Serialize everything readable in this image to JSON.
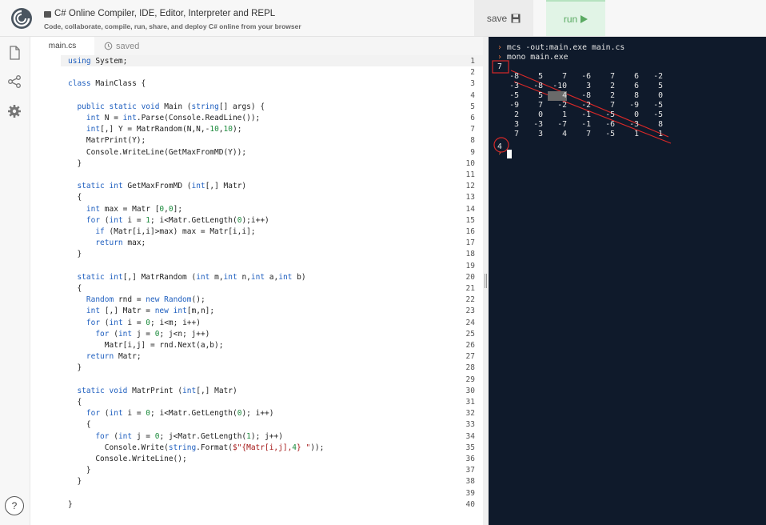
{
  "app": {
    "title": "C# Online Compiler, IDE, Editor, Interpreter and REPL",
    "subtitle": "Code, collaborate, compile, run, share, and deploy C# online from your browser"
  },
  "toolbar": {
    "save_label": "save",
    "run_label": "run"
  },
  "tabs": {
    "file": "main.cs",
    "status": "saved"
  },
  "help_label": "?",
  "editor": {
    "lines": [
      "using System;",
      "",
      "class MainClass {",
      "",
      "  public static void Main (string[] args) {",
      "    int N = int.Parse(Console.ReadLine());",
      "    int[,] Y = MatrRandom(N,N,-10,10);",
      "    MatrPrint(Y);",
      "    Console.WriteLine(GetMaxFromMD(Y));",
      "  }",
      "",
      "  static int GetMaxFromMD (int[,] Matr)",
      "  {",
      "    int max = Matr [0,0];",
      "    for (int i = 1; i<Matr.GetLength(0);i++)",
      "      if (Matr[i,i]>max) max = Matr[i,i];",
      "      return max;",
      "  }",
      "",
      "  static int[,] MatrRandom (int m,int n,int a,int b)",
      "  {",
      "    Random rnd = new Random();",
      "    int [,] Matr = new int[m,n];",
      "    for (int i = 0; i<m; i++)",
      "      for (int j = 0; j<n; j++)",
      "        Matr[i,j] = rnd.Next(a,b);",
      "    return Matr;",
      "  }",
      "",
      "  static void MatrPrint (int[,] Matr)",
      "  {",
      "    for (int i = 0; i<Matr.GetLength(0); i++)",
      "    {",
      "      for (int j = 0; j<Matr.GetLength(1); j++)",
      "        Console.Write(string.Format($\"{Matr[i,j],4} \"));",
      "      Console.WriteLine();",
      "    }",
      "  }",
      "",
      "}"
    ]
  },
  "terminal": {
    "commands": [
      "mcs -out:main.exe main.cs",
      "mono main.exe"
    ],
    "input": "7",
    "matrix": [
      [
        -8,
        5,
        7,
        -6,
        7,
        6,
        -2
      ],
      [
        -3,
        -8,
        -10,
        3,
        2,
        6,
        5
      ],
      [
        -5,
        5,
        4,
        -8,
        2,
        8,
        0
      ],
      [
        -9,
        7,
        -2,
        -2,
        7,
        -9,
        -5
      ],
      [
        2,
        0,
        1,
        -1,
        -5,
        0,
        -5
      ],
      [
        3,
        -3,
        -7,
        -1,
        -6,
        -3,
        8
      ],
      [
        7,
        3,
        4,
        7,
        -5,
        1,
        1
      ]
    ],
    "result": "4",
    "prompt_symbol": "›"
  },
  "colors": {
    "terminal_bg": "#0f1a2b",
    "prompt": "#e2733e",
    "annotation": "#d62828",
    "run_green": "#5aaa62"
  }
}
